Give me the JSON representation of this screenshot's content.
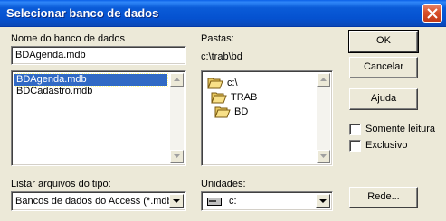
{
  "window": {
    "title": "Selecionar banco de dados"
  },
  "labels": {
    "db_name": "Nome do banco de dados",
    "folders": "Pastas:",
    "file_types": "Listar arquivos do tipo:",
    "drives": "Unidades:"
  },
  "db_name_input": {
    "value": "BDAgenda.mdb"
  },
  "file_list": {
    "items": [
      "BDAgenda.mdb",
      "BDCadastro.mdb"
    ],
    "selected": "BDAgenda.mdb"
  },
  "current_path": "c:\\trab\\bd",
  "folder_tree": [
    {
      "label": "c:\\",
      "icon": "open-folder-icon"
    },
    {
      "label": "TRAB",
      "icon": "open-folder-icon"
    },
    {
      "label": "BD",
      "icon": "open-folder-icon"
    }
  ],
  "file_type_select": {
    "value": "Bancos de dados do Access (*.mdb)"
  },
  "drive_select": {
    "value": "c:",
    "icon": "drive-icon"
  },
  "buttons": {
    "ok": "OK",
    "cancel": "Cancelar",
    "help": "Ajuda",
    "network": "Rede..."
  },
  "checkboxes": {
    "read_only": {
      "label": "Somente leitura",
      "checked": false
    },
    "exclusive": {
      "label": "Exclusivo",
      "checked": false
    }
  },
  "colors": {
    "titlebar": "#0553d3",
    "selection": "#316ac5",
    "dialog_bg": "#ece9d8",
    "close_button": "#d8502a"
  }
}
